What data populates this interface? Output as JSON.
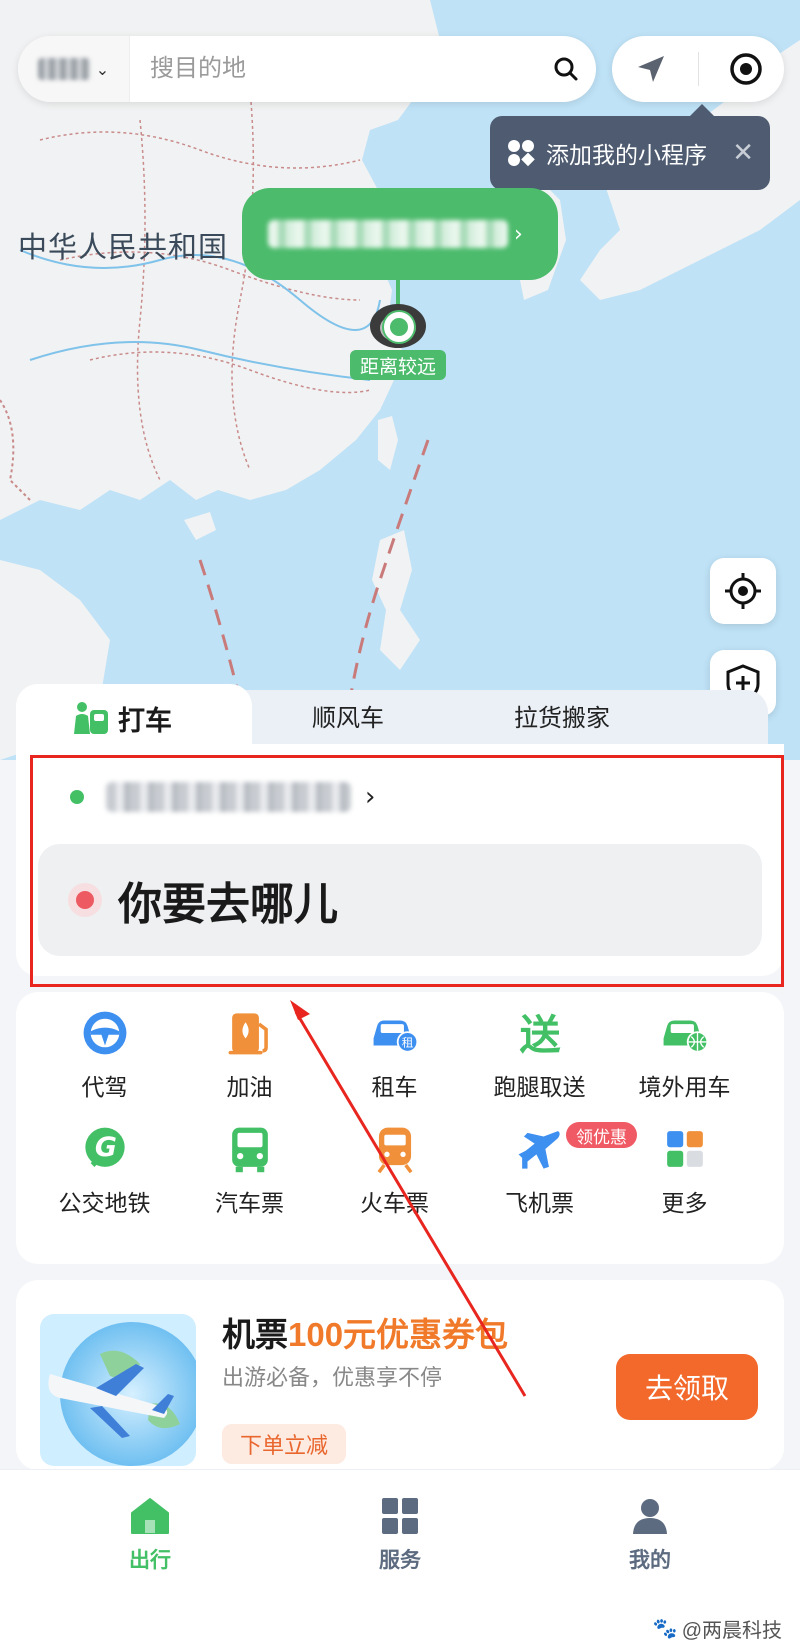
{
  "map": {
    "country_label": "中华人民共和国",
    "location_bubble_arrow": "›",
    "distance_label": "距离较远"
  },
  "search": {
    "city_chevron": "⌄",
    "placeholder": "搜目的地"
  },
  "tooltip": {
    "text": "添加我的小程序",
    "close": "✕"
  },
  "ride_tabs": [
    {
      "label": "打车",
      "active": true
    },
    {
      "label": "顺风车",
      "active": false
    },
    {
      "label": "拉货搬家",
      "active": false
    }
  ],
  "ride": {
    "from_arrow": "›",
    "destination_placeholder": "你要去哪儿"
  },
  "services": [
    {
      "label": "代驾",
      "icon": "steering-wheel-icon"
    },
    {
      "label": "加油",
      "icon": "fuel-pump-icon"
    },
    {
      "label": "租车",
      "icon": "rental-car-icon"
    },
    {
      "label": "跑腿取送",
      "icon": "delivery-icon"
    },
    {
      "label": "境外用车",
      "icon": "overseas-car-icon"
    },
    {
      "label": "公交地铁",
      "icon": "bus-metro-icon"
    },
    {
      "label": "汽车票",
      "icon": "bus-ticket-icon"
    },
    {
      "label": "火车票",
      "icon": "train-ticket-icon"
    },
    {
      "label": "飞机票",
      "icon": "plane-ticket-icon"
    },
    {
      "label": "更多",
      "icon": "more-grid-icon"
    }
  ],
  "service_badge": "领优惠",
  "promo": {
    "title_prefix": "机票",
    "title_highlight": "100元优惠券包",
    "subtitle": "出游必备，优惠享不停",
    "tag": "下单立减",
    "button": "去领取"
  },
  "bottom_nav": [
    {
      "label": "出行",
      "active": true
    },
    {
      "label": "服务",
      "active": false
    },
    {
      "label": "我的",
      "active": false
    }
  ],
  "watermark": "@两晨科技",
  "colors": {
    "brand_green": "#4cbb6c",
    "accent_orange": "#f2692b",
    "annotation_red": "#e8261f",
    "map_sea": "#bfe2f6"
  }
}
